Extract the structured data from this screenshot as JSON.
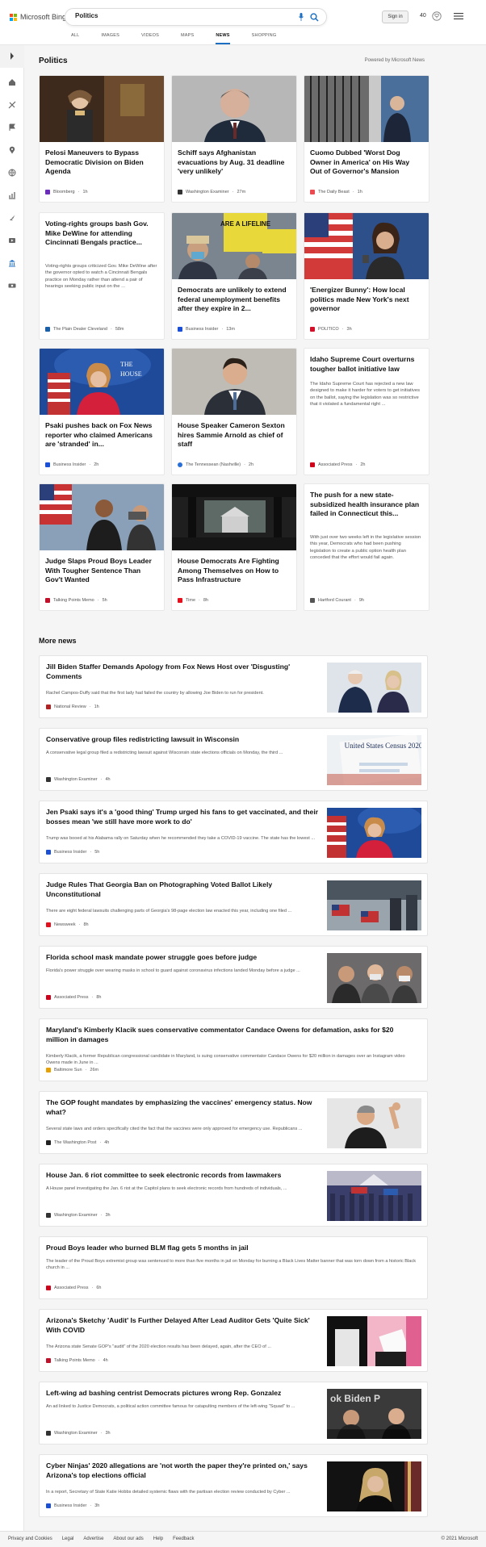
{
  "header": {
    "brand": "Microsoft Bing",
    "search_value": "Politics",
    "signin": "Sign in",
    "rewards_count": "40",
    "scopes": [
      "ALL",
      "IMAGES",
      "VIDEOS",
      "MAPS",
      "NEWS",
      "SHOPPING"
    ],
    "active_scope": "NEWS"
  },
  "politics": {
    "title": "Politics",
    "powered_by": "Powered by Microsoft News",
    "cards": [
      {
        "title": "Pelosi Maneuvers to Bypass Democratic Division on Biden Agenda",
        "source": "Bloomberg",
        "time": "1h",
        "logo_color": "#6a2eb8"
      },
      {
        "title": "Schiff says Afghanistan evacuations by Aug. 31 deadline 'very unlikely'",
        "source": "Washington Examiner",
        "time": "27m",
        "logo_color": "#333333"
      },
      {
        "title": "Cuomo Dubbed 'Worst Dog Owner in America' on His Way Out of Governor's Mansion",
        "source": "The Daily Beast",
        "time": "1h",
        "logo_color": "#e94b50"
      },
      {
        "title": "Voting-rights groups bash Gov. Mike DeWine for attending Cincinnati Bengals practice...",
        "body": "Voting-rights groups criticized Gov. Mike DeWine after the governor opted to watch a Cincinnati Bengals practice on Monday rather than attend a pair of hearings seeking public input on the ...",
        "source": "The Plain Dealer Cleveland",
        "time": "58m",
        "logo_color": "#1a5fa8"
      },
      {
        "title": "Democrats are unlikely to extend federal unemployment benefits after they expire in 2...",
        "source": "Business Insider",
        "time": "13m",
        "logo_color": "#1a4fd6"
      },
      {
        "title": "'Energizer Bunny': How local politics made New York's next governor",
        "source": "POLITICO",
        "time": "3h",
        "logo_color": "#d3102a"
      },
      {
        "title": "Psaki pushes back on Fox News reporter who claimed Americans are 'stranded' in...",
        "source": "Business Insider",
        "time": "2h",
        "logo_color": "#1a4fd6"
      },
      {
        "title": "House Speaker Cameron Sexton hires Sammie Arnold as chief of staff",
        "source": "The Tennessean (Nashville)",
        "time": "2h",
        "logo_color": "#2a6fd6"
      },
      {
        "title": "Idaho Supreme Court overturns tougher ballot initiative law",
        "body": "The Idaho Supreme Court has rejected a new law designed to make it harder for voters to get initiatives on the ballot, saying the legislation was so restrictive that it violated a fundamental right ...",
        "source": "Associated Press",
        "time": "2h",
        "logo_color": "#d0021b"
      },
      {
        "title": "Judge Slaps Proud Boys Leader With Tougher Sentence Than Gov't Wanted",
        "source": "Talking Points Memo",
        "time": "5h",
        "logo_color": "#c0102a"
      },
      {
        "title": "House Democrats Are Fighting Among Themselves on How to Pass Infrastructure",
        "source": "Time",
        "time": "8h",
        "logo_color": "#e4101e"
      },
      {
        "title": "The push for a new state-subsidized health insurance plan failed in Connecticut this...",
        "body": "With just over two weeks left in the legislative session this year, Democrats who had been pushing legislation to create a public option health plan conceded that the effort would fail again.",
        "source": "Hartford Courant",
        "time": "9h",
        "logo_color": "#555555"
      }
    ]
  },
  "more_news": {
    "title": "More news",
    "items": [
      {
        "title": "Jill Biden Staffer Demands Apology from Fox News Host over 'Disgusting' Comments",
        "body": "Rachel Campos-Duffy said that the first lady had failed the country by allowing Joe Biden to run for president.",
        "source": "National Review",
        "time": "1h",
        "logo_color": "#b22222"
      },
      {
        "title": "Conservative group files redistricting lawsuit in Wisconsin",
        "body": "A conservative legal group filed a redistricting lawsuit against Wisconsin state elections officials on Monday, the third ...",
        "source": "Washington Examiner",
        "time": "4h",
        "logo_color": "#333333",
        "image_text": "United States Census 2020"
      },
      {
        "title": "Jen Psaki says it's a 'good thing' Trump urged his fans to get vaccinated, and their bosses mean 'we still have more work to do'",
        "body": "Trump was booed at his Alabama rally on Saturday when he recommended they take a COVID-19 vaccine. The state has the lowest ...",
        "source": "Business Insider",
        "time": "5h",
        "logo_color": "#1a4fd6"
      },
      {
        "title": "Judge Rules That Georgia Ban on Photographing Voted Ballot Likely Unconstitutional",
        "body": "There are eight federal lawsuits challenging parts of Georgia's 98-page election law enacted this year, including one filed ...",
        "source": "Newsweek",
        "time": "8h",
        "logo_color": "#e4101e"
      },
      {
        "title": "Florida school mask mandate power struggle goes before judge",
        "body": "Florida's power struggle over wearing masks in school to guard against coronavirus infections landed Monday before a judge ...",
        "source": "Associated Press",
        "time": "8h",
        "logo_color": "#d0021b"
      },
      {
        "title": "Maryland's Kimberly Klacik sues conservative commentator Candace Owens for defamation, asks for $20 million in damages",
        "body": "Kimberly Klacik, a former Republican congressional candidate in Maryland, is suing conservative commentator Candace Owens for $20 million in damages over an Instagram video Owens made in June in ...",
        "source": "Baltimore Sun",
        "time": "26m",
        "logo_color": "#e6a100"
      },
      {
        "title": "The GOP fought mandates by emphasizing the vaccines' emergency status. Now what?",
        "body": "Several state laws and orders specifically cited the fact that the vaccines were only approved for emergency use. Republicans ...",
        "source": "The Washington Post",
        "time": "4h",
        "logo_color": "#222222"
      },
      {
        "title": "House Jan. 6 riot committee to seek electronic records from lawmakers",
        "body": "A House panel investigating the Jan. 6 riot at the Capitol plans to seek electronic records from hundreds of individuals, ...",
        "source": "Washington Examiner",
        "time": "3h",
        "logo_color": "#333333"
      },
      {
        "title": "Proud Boys leader who burned BLM flag gets 5 months in jail",
        "body": "The leader of the Proud Boys extremist group was sentenced to more than five months in jail on Monday for burning a Black Lives Matter banner that was torn down from a historic Black church in ...",
        "source": "Associated Press",
        "time": "6h",
        "logo_color": "#d0021b"
      },
      {
        "title": "Arizona's Sketchy 'Audit' Is Further Delayed After Lead Auditor Gets 'Quite Sick' With COVID",
        "body": "The Arizona state Senate GOP's \"audit\" of the 2020 election results has been delayed, again, after the CEO of ...",
        "source": "Talking Points Memo",
        "time": "4h",
        "logo_color": "#c0102a"
      },
      {
        "title": "Left-wing ad bashing centrist Democrats pictures wrong Rep. Gonzalez",
        "body": "An ad linked to Justice Democrats, a political action committee famous for catapulting members of the left-wing \"Squad\" to ...",
        "source": "Washington Examiner",
        "time": "3h",
        "logo_color": "#333333",
        "image_text": "ok Biden P"
      },
      {
        "title": "Cyber Ninjas' 2020 allegations are 'not worth the paper they're printed on,' says Arizona's top elections official",
        "body": "In a report, Secretary of State Katie Hobbs detailed systemic flaws with the partisan election review conducted by Cyber ...",
        "source": "Business Insider",
        "time": "3h",
        "logo_color": "#1a4fd6"
      }
    ]
  },
  "footer": {
    "links": [
      "Privacy and Cookies",
      "Legal",
      "Advertise",
      "About our ads",
      "Help",
      "Feedback"
    ],
    "copyright": "© 2021 Microsoft"
  }
}
